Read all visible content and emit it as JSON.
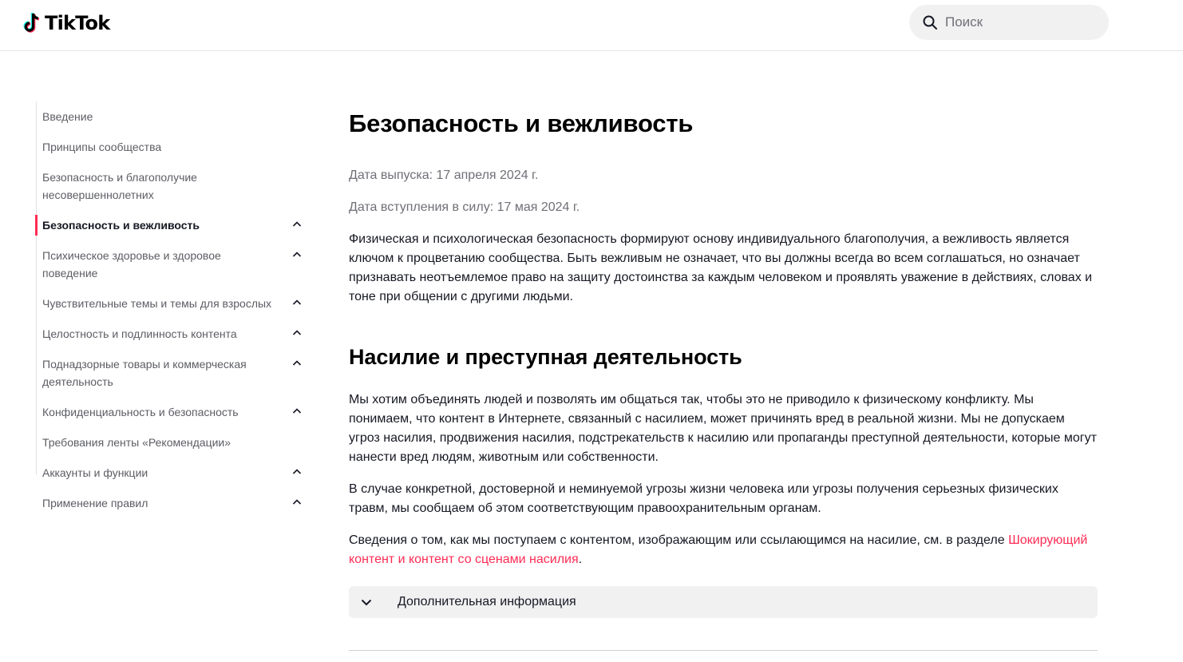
{
  "header": {
    "logo_text": "TikTok",
    "search_placeholder": "Поиск"
  },
  "sidebar": {
    "items": [
      {
        "label": "Введение",
        "expandable": false,
        "active": false
      },
      {
        "label": "Принципы сообщества",
        "expandable": false,
        "active": false
      },
      {
        "label": "Безопасность и благополучие несовершеннолетних",
        "expandable": false,
        "active": false
      },
      {
        "label": "Безопасность и вежливость",
        "expandable": true,
        "active": true
      },
      {
        "label": "Психическое здоровье и здоровое поведение",
        "expandable": true,
        "active": false
      },
      {
        "label": "Чувствительные темы и темы для взрослых",
        "expandable": true,
        "active": false
      },
      {
        "label": "Целостность и подлинность контента",
        "expandable": true,
        "active": false
      },
      {
        "label": "Поднадзорные товары и коммерческая деятельность",
        "expandable": true,
        "active": false
      },
      {
        "label": "Конфиденциальность и безопасность",
        "expandable": true,
        "active": false
      },
      {
        "label": "Требования ленты «Рекомендации»",
        "expandable": false,
        "active": false
      },
      {
        "label": "Аккаунты и функции",
        "expandable": true,
        "active": false
      },
      {
        "label": "Применение правил",
        "expandable": true,
        "active": false
      }
    ]
  },
  "main": {
    "title": "Безопасность и вежливость",
    "release_date": "Дата выпуска: 17 апреля 2024 г.",
    "effective_date": "Дата вступления в силу: 17 мая 2024 г.",
    "intro": "Физическая и психологическая безопасность формируют основу индивидуального благополучия, а вежливость является ключом к процветанию сообщества. Быть вежливым не означает, что вы должны всегда во всем соглашаться, но означает признавать неотъемлемое право на защиту достоинства за каждым человеком и проявлять уважение в действиях, словах и тоне при общении с другими людьми.",
    "section_title": "Насилие и преступная деятельность",
    "para1": "Мы хотим объединять людей и позволять им общаться так, чтобы это не приводило к физическому конфликту. Мы понимаем, что контент в Интернете, связанный с насилием, может причинять вред в реальной жизни. Мы не допускаем угроз насилия, продвижения насилия, подстрекательств к насилию или пропаганды преступной деятельности, которые могут нанести вред людям, животным или собственности.",
    "para2": "В случае конкретной, достоверной и неминуемой угрозы жизни человека или угрозы получения серьезных физических травм, мы сообщаем об этом соответствующим правоохранительным органам.",
    "para3_prefix": "Сведения о том, как мы поступаем с контентом, изображающим или ссылающимся на насилие, см. в разделе ",
    "para3_link": "Шокирующий контент и контент со сценами насилия",
    "para3_suffix": ".",
    "accordion_label": "Дополнительная информация"
  },
  "colors": {
    "accent": "#fe2c55",
    "text": "#161823",
    "muted": "#6f7077",
    "search_bg": "#f1f1f2"
  }
}
